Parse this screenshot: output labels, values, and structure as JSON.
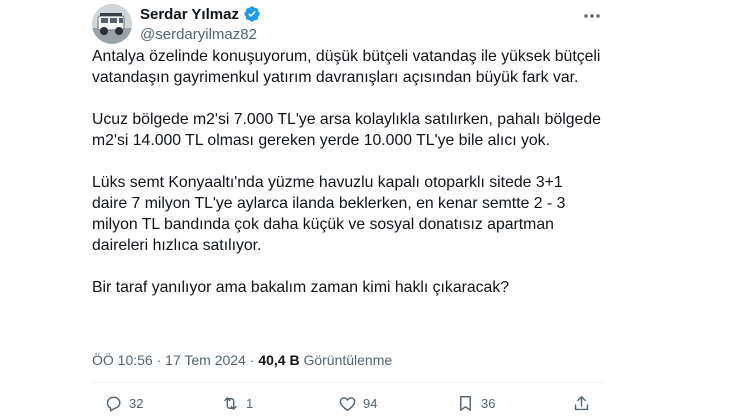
{
  "author": {
    "name": "Serdar Yılmaz",
    "handle": "@serdaryilmaz82"
  },
  "icons": {
    "avatar": "avatar-vehicle-photo",
    "verified": "verified-badge-icon",
    "more": "more-options-icon"
  },
  "tweet": {
    "paragraphs": [
      "Antalya özelinde konuşuyorum, düşük bütçeli vatandaş ile yüksek bütçeli vatandaşın gayrimenkul yatırım davranışları açısından büyük fark var.",
      "Ucuz bölgede m2'si 7.000 TL'ye arsa kolaylıkla satılırken, pahalı bölgede m2'si 14.000 TL olması gereken yerde 10.000 TL'ye bile alıcı yok.",
      "Lüks semt Konyaaltı'nda yüzme havuzlu kapalı otoparklı sitede 3+1 daire 7 milyon TL'ye aylarca ilanda beklerken, en kenar semtte 2 - 3 milyon TL bandında çok daha küçük ve sosyal donatısız apartman daireleri hızlıca satılıyor.",
      "Bir taraf yanılıyor ama bakalım zaman kimi haklı çıkaracak?"
    ],
    "time": "ÖÖ 10:56",
    "date": "17 Tem 2024",
    "separator": "·",
    "views": "40,4 B",
    "views_label": "Görüntülenme"
  },
  "actions": {
    "reply_count": "32",
    "retweet_count": "1",
    "like_count": "94",
    "bookmark_count": "36"
  },
  "colors": {
    "verified": "#1d9bf0",
    "secondary_text": "#536471",
    "primary_text": "#0f1419"
  }
}
